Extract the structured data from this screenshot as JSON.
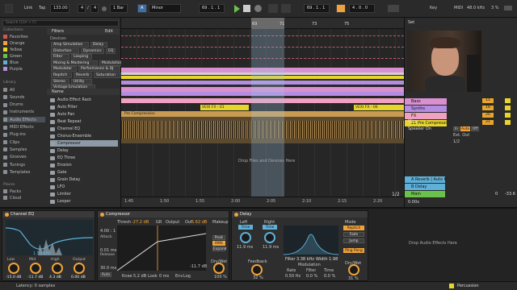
{
  "colors": {
    "orange": "#f0a33a",
    "yellow": "#e7d52c",
    "green": "#6bc24a",
    "blue": "#5fb0d8",
    "purple": "#b48de0",
    "red": "#d9534f"
  },
  "transport": {
    "link": "Link",
    "tap": "Tap",
    "tempo": "133.00",
    "time_sig_num": "4",
    "time_sig_den": "4",
    "metronome": "1 Bar",
    "key": "A",
    "scale": "Minor",
    "position": "69 . 1 . 1",
    "loop_start": "69 . 1 . 1",
    "loop_len": "4 . 0 . 0",
    "key_label": "Key",
    "midi_label": "MIDI",
    "sample_rate": "48.0 kHz",
    "cpu": "3 %"
  },
  "browser": {
    "search_placeholder": "Search (Ctrl + F)",
    "filters_label": "Filters",
    "edit_label": "Edit",
    "collections_label": "Collections",
    "collections": [
      {
        "label": "Favorites",
        "color": "#d9534f"
      },
      {
        "label": "Orange",
        "color": "#f0a33a"
      },
      {
        "label": "Yellow",
        "color": "#e7d52c"
      },
      {
        "label": "Green",
        "color": "#6bc24a"
      },
      {
        "label": "Blue",
        "color": "#5fb0d8"
      },
      {
        "label": "Purple",
        "color": "#b48de0"
      }
    ],
    "library_label": "Library",
    "library": [
      "All",
      "Sounds",
      "Drums",
      "Instruments",
      "Audio Effects",
      "MIDI Effects",
      "Plug-ins",
      "Clips",
      "Samples",
      "Grooves",
      "Tunings",
      "Templates"
    ],
    "places_label": "Places",
    "places": [
      "Packs",
      "Cloud"
    ],
    "devices_label": "Devices",
    "tags": [
      [
        "Amp Simulation",
        "Delay"
      ],
      [
        "Distortion",
        "Dynamics",
        "EQ"
      ],
      [
        "Filter",
        "Looping"
      ],
      [
        "Mixing & Mastering",
        "Modulation"
      ],
      [
        "Modulator",
        "Performance & DJ"
      ],
      [
        "Repitch",
        "Reverb",
        "Saturation"
      ],
      [
        "Stereo",
        "Utility"
      ],
      [
        "Vintage Emulation"
      ]
    ],
    "name_header": "Name",
    "devices": [
      "Audio Effect Rack",
      "Auto Filter",
      "Auto Pan",
      "Beat Repeat",
      "Channel EQ",
      "Chorus-Ensemble",
      "Compressor",
      "Delay",
      "EQ Three",
      "Erosion",
      "Gate",
      "Grain Delay",
      "LFO",
      "Limiter",
      "Looper"
    ]
  },
  "arrangement": {
    "ruler": [
      "69",
      "71",
      "73",
      "75"
    ],
    "time_ruler": [
      "1:45",
      "1:50",
      "1:55",
      "2:00",
      "2:05",
      "2:10",
      "2:15",
      "2:20"
    ],
    "clip_vexi_1": "VEXI FX - 01",
    "clip_vexi_6": "VEXI FX - 06",
    "clip_pre_comp": "Pre Compression",
    "drop_hint": "Drop Files and Devices Here"
  },
  "tracks": {
    "set_label": "Set",
    "items": [
      {
        "name": "Bass",
        "num": "11"
      },
      {
        "name": "Synths",
        "num": "18"
      },
      {
        "name": "FX",
        "num": "20"
      },
      {
        "name": "21 Pre Compressi",
        "num": "21"
      }
    ],
    "mixer_label": "Mixer",
    "speaker_label": "Speaker On",
    "in_label": "In",
    "auto_label": "Auto",
    "off_label": "Off",
    "ext_out": "Ext. Out",
    "out_value": "1/2",
    "returns": [
      {
        "name": "A Reverb | Auto P",
        "color": "#5fb0d8"
      },
      {
        "name": "B Delay",
        "color": "#5fb0d8"
      },
      {
        "name": "Main",
        "color": "#6bc24a"
      }
    ],
    "main_out": "1/2",
    "main_value": "0",
    "main_db": "-33.6",
    "zoom": "0.00x"
  },
  "devices": {
    "channel_eq": {
      "title": "Channel EQ",
      "freq_display": "1.50 kHz",
      "knobs": [
        {
          "label": "Low",
          "value": "-15.0 dB"
        },
        {
          "label": "Mid",
          "value": "-11.7 dB"
        },
        {
          "label": "High",
          "value": "4.3 dB"
        },
        {
          "label": "Output",
          "value": "0.00 dB"
        }
      ]
    },
    "compressor": {
      "title": "Compressor",
      "ratio": "4.00 : 1",
      "attack": "0.01 ms",
      "release": "30.0 ms",
      "auto": "Auto",
      "thresh_label": "Thresh",
      "thresh_value": "-27.2 dB",
      "gr_label": "GR",
      "output_label": "Output",
      "out_label": "Out",
      "out_value": "5.62 dB",
      "knee_label": "Knee",
      "knee_value": "5.2 dB",
      "look_label": "Look",
      "look_value": "0 ms",
      "env_label": "Env",
      "env_value": "Log",
      "meter_value": "-11.7 dB",
      "makeup": "Makeup",
      "peak": "Peak",
      "rms": "RMS",
      "expand": "Expand",
      "dry_wet_label": "Dry/Wet",
      "dry_wet_value": "100 %"
    },
    "delay": {
      "title": "Delay",
      "left_label": "Left",
      "right_label": "Right",
      "left_time": "Time",
      "right_time": "Time",
      "left_value": "11.9 ms",
      "right_value": "11.9 ms",
      "feedback_label": "Feedback",
      "feedback_value": "32 %",
      "filter_freq": "Filter 3.38 kHz",
      "width": "Width 1.98",
      "modulation_label": "Modulation",
      "rate_label": "Rate",
      "rate_value": "0.50 Hz",
      "filter_label": "Filter",
      "filter_value": "0.0 %",
      "time_label": "Time",
      "time_value": "0.0 %",
      "mode_label": "Mode",
      "modes": [
        "Repitch",
        "Fade",
        "Jump"
      ],
      "ping_pong": "Ping Pong",
      "dry_wet_label": "Dry/Wet",
      "dry_wet_value": "31 %",
      "drop_hint": "Drop Audio Effects Here"
    }
  },
  "status": {
    "latency": "Latency: 0 samples",
    "track_name": "Percussion"
  }
}
